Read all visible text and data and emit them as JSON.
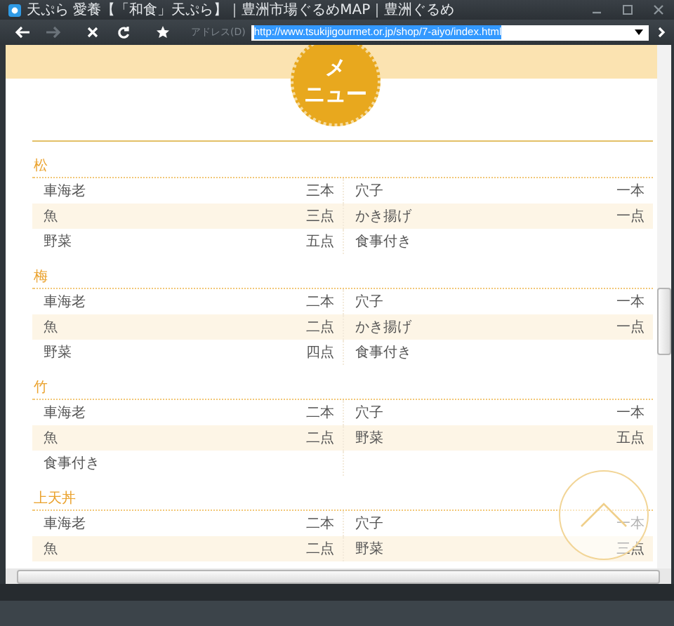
{
  "window": {
    "title": "天ぷら 愛養【「和食」天ぷら】｜豊洲市場ぐるめMAP｜豊洲ぐるめ"
  },
  "toolbar": {
    "buttons": [
      {
        "kind": "back",
        "disabled": false
      },
      {
        "kind": "forward",
        "disabled": true
      },
      {
        "kind": "stop",
        "disabled": false
      },
      {
        "kind": "refresh",
        "disabled": false
      },
      {
        "kind": "favorite",
        "disabled": false
      }
    ],
    "address_label": "アドレス(D)",
    "address": {
      "value": "http://www.tsukijigourmet.or.jp/shop/7-aiyo/index.html",
      "selected": true
    }
  },
  "page": {
    "badge_lines": [
      "メ",
      "ニュー"
    ],
    "sections": [
      {
        "title": "松",
        "items": [
          {
            "name": "車海老",
            "qty": "三本"
          },
          {
            "name": "穴子",
            "qty": "一本"
          },
          {
            "name": "魚",
            "qty": "三点"
          },
          {
            "name": "かき揚げ",
            "qty": "一点"
          },
          {
            "name": "野菜",
            "qty": "五点"
          },
          {
            "name": "食事付き"
          }
        ]
      },
      {
        "title": "梅",
        "items": [
          {
            "name": "車海老",
            "qty": "二本"
          },
          {
            "name": "穴子",
            "qty": "一本"
          },
          {
            "name": "魚",
            "qty": "二点"
          },
          {
            "name": "かき揚げ",
            "qty": "一点"
          },
          {
            "name": "野菜",
            "qty": "四点"
          },
          {
            "name": "食事付き"
          }
        ]
      },
      {
        "title": "竹",
        "items": [
          {
            "name": "車海老",
            "qty": "二本"
          },
          {
            "name": "穴子",
            "qty": "一本"
          },
          {
            "name": "魚",
            "qty": "二点"
          },
          {
            "name": "野菜",
            "qty": "五点"
          },
          {
            "name": "食事付き"
          }
        ]
      },
      {
        "title": "上天丼",
        "items": [
          {
            "name": "車海老",
            "qty": "二本"
          },
          {
            "name": "穴子",
            "qty": "一本"
          },
          {
            "name": "魚",
            "qty": "二点"
          },
          {
            "name": "野菜",
            "qty": "三点"
          }
        ]
      }
    ]
  }
}
